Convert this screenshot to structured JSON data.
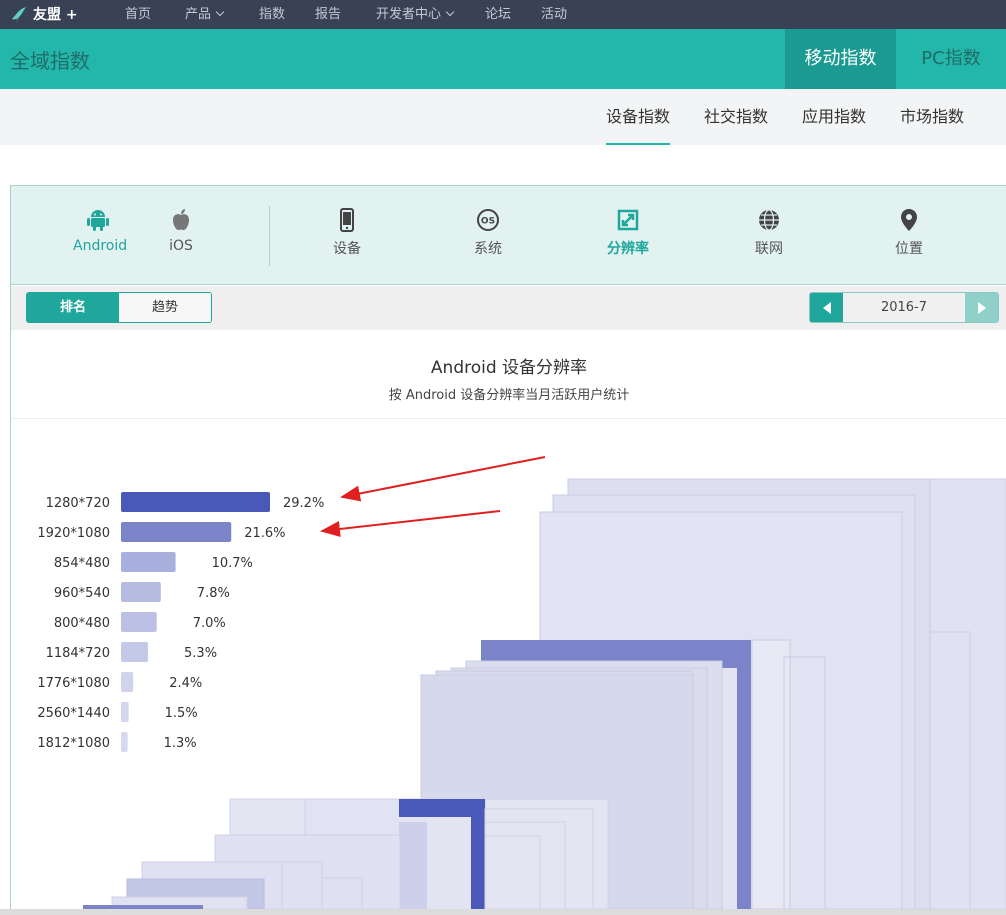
{
  "topnav": {
    "brand": "友盟 +",
    "items": [
      {
        "label": "首页",
        "dropdown": false
      },
      {
        "label": "产品",
        "dropdown": true
      },
      {
        "label": "指数",
        "dropdown": false
      },
      {
        "label": "报告",
        "dropdown": false
      },
      {
        "label": "开发者中心",
        "dropdown": true
      },
      {
        "label": "论坛",
        "dropdown": false
      },
      {
        "label": "活动",
        "dropdown": false
      }
    ]
  },
  "header": {
    "title": "全域指数",
    "tabs": [
      {
        "label": "移动指数",
        "active": true
      },
      {
        "label": "PC指数",
        "active": false
      }
    ]
  },
  "subtabs": [
    {
      "label": "设备指数",
      "active": true
    },
    {
      "label": "社交指数",
      "active": false
    },
    {
      "label": "应用指数",
      "active": false
    },
    {
      "label": "市场指数",
      "active": false
    }
  ],
  "platforms": [
    {
      "label": "Android",
      "icon": "android-icon",
      "active": true
    },
    {
      "label": "iOS",
      "icon": "apple-icon",
      "active": false
    }
  ],
  "categories": [
    {
      "label": "设备",
      "icon": "phone-icon",
      "active": false
    },
    {
      "label": "系统",
      "icon": "os-icon",
      "active": false
    },
    {
      "label": "分辨率",
      "icon": "resolution-icon",
      "active": true
    },
    {
      "label": "联网",
      "icon": "globe-icon",
      "active": false
    },
    {
      "label": "位置",
      "icon": "location-pin-icon",
      "active": false
    }
  ],
  "view_toggle": {
    "rank": "排名",
    "trend": "趋势"
  },
  "date_picker": {
    "value": "2016-7"
  },
  "colors": {
    "teal": "#23b7ab",
    "teal_dark": "#1a9a90",
    "bar_dark": "#4a58b8",
    "annotation_arrow": "#e02020"
  },
  "chart_data": {
    "type": "bar",
    "orientation": "horizontal",
    "title": "Android 设备分辨率",
    "subtitle": "按 Android 设备分辨率当月活跃用户统计",
    "categories": [
      "1280*720",
      "1920*1080",
      "854*480",
      "960*540",
      "800*480",
      "1184*720",
      "1776*1080",
      "2560*1440",
      "1812*1080"
    ],
    "values": [
      29.2,
      21.6,
      10.7,
      7.8,
      7.0,
      5.3,
      2.4,
      1.5,
      1.3
    ],
    "labels": [
      "29.2%",
      "21.6%",
      "10.7%",
      "7.8%",
      "7.0%",
      "5.3%",
      "2.4%",
      "1.5%",
      "1.3%"
    ],
    "unit": "%",
    "annotations": [
      "red arrow pointing to 29.2%",
      "red arrow pointing to 21.6%"
    ],
    "illustration": "nested screen-size rectangles, one per resolution, highlighted 1920*1080 and 1280*720"
  }
}
